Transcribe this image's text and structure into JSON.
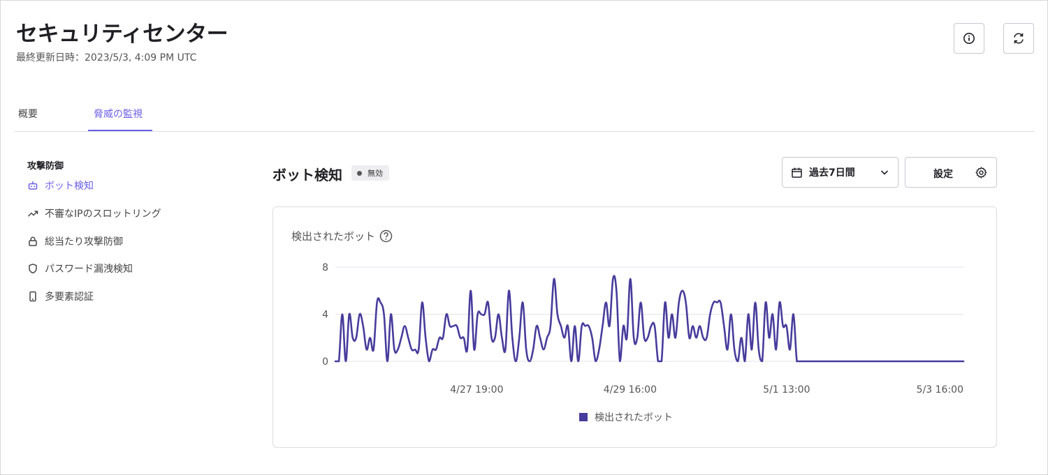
{
  "header": {
    "title": "セキュリティセンター",
    "last_updated": "最終更新日時：2023/5/3, 4:09 PM UTC"
  },
  "tabs": [
    {
      "label": "概要",
      "active": false
    },
    {
      "label": "脅威の監視",
      "active": true
    }
  ],
  "sidebar": {
    "heading": "攻撃防御",
    "items": [
      {
        "label": "ボット検知",
        "icon": "robot-icon",
        "active": true
      },
      {
        "label": "不審なIPのスロットリング",
        "icon": "trending-up-icon",
        "active": false
      },
      {
        "label": "総当たり攻撃防御",
        "icon": "lock-icon",
        "active": false
      },
      {
        "label": "パスワード漏洩検知",
        "icon": "shield-icon",
        "active": false
      },
      {
        "label": "多要素認証",
        "icon": "phone-icon",
        "active": false
      }
    ]
  },
  "main": {
    "title": "ボット検知",
    "status_badge": "無効",
    "range_select": "過去7日間",
    "settings_label": "設定"
  },
  "colors": {
    "accent": "#6b5fe6",
    "series": "#473c9c"
  },
  "chart_data": {
    "type": "line",
    "title": "検出されたボット",
    "ylim": [
      0,
      8
    ],
    "yticks": [
      0,
      4,
      8
    ],
    "x_tick_labels": [
      "4/27 19:00",
      "4/29 16:00",
      "5/1 13:00",
      "5/3 16:00"
    ],
    "legend_placement": "bottom-center",
    "grid": true,
    "series": [
      {
        "name": "検出されたボット",
        "values": [
          0,
          0,
          4,
          0,
          4,
          2,
          2,
          4,
          3,
          1,
          2,
          1,
          5,
          5,
          4,
          0,
          4,
          1,
          1,
          2,
          3,
          2,
          1,
          1,
          1,
          5,
          2,
          0,
          1,
          1,
          2,
          2,
          4,
          3,
          3,
          3,
          2,
          2,
          1,
          6,
          1,
          4,
          4,
          4,
          5,
          2,
          2,
          4,
          2,
          1,
          6,
          2,
          0,
          2,
          5,
          1,
          0,
          1,
          3,
          2,
          1,
          2,
          3,
          7,
          4,
          3,
          2,
          3,
          0,
          3,
          0,
          3,
          3,
          3,
          2,
          0,
          1,
          3,
          5,
          3,
          7,
          6,
          0,
          3,
          2,
          7,
          2,
          2,
          5,
          2,
          2,
          3,
          3,
          0,
          0,
          5,
          2,
          4,
          2,
          5,
          6,
          5,
          2,
          3,
          2,
          3,
          2,
          2,
          4,
          5,
          5,
          5,
          3,
          1,
          4,
          1,
          0,
          2,
          0,
          4,
          1,
          5,
          1,
          0,
          5,
          2,
          4,
          1,
          5,
          3,
          3,
          1,
          4,
          0,
          0,
          0,
          0,
          0,
          0,
          0,
          0,
          0,
          0,
          0,
          0,
          0,
          0,
          0,
          0,
          0,
          0,
          0,
          0,
          0,
          0,
          0,
          0,
          0,
          0,
          0,
          0,
          0,
          0,
          0,
          0,
          0,
          0,
          0,
          0,
          0,
          0,
          0,
          0,
          0,
          0,
          0,
          0,
          0,
          0,
          0,
          0,
          0
        ]
      }
    ]
  }
}
